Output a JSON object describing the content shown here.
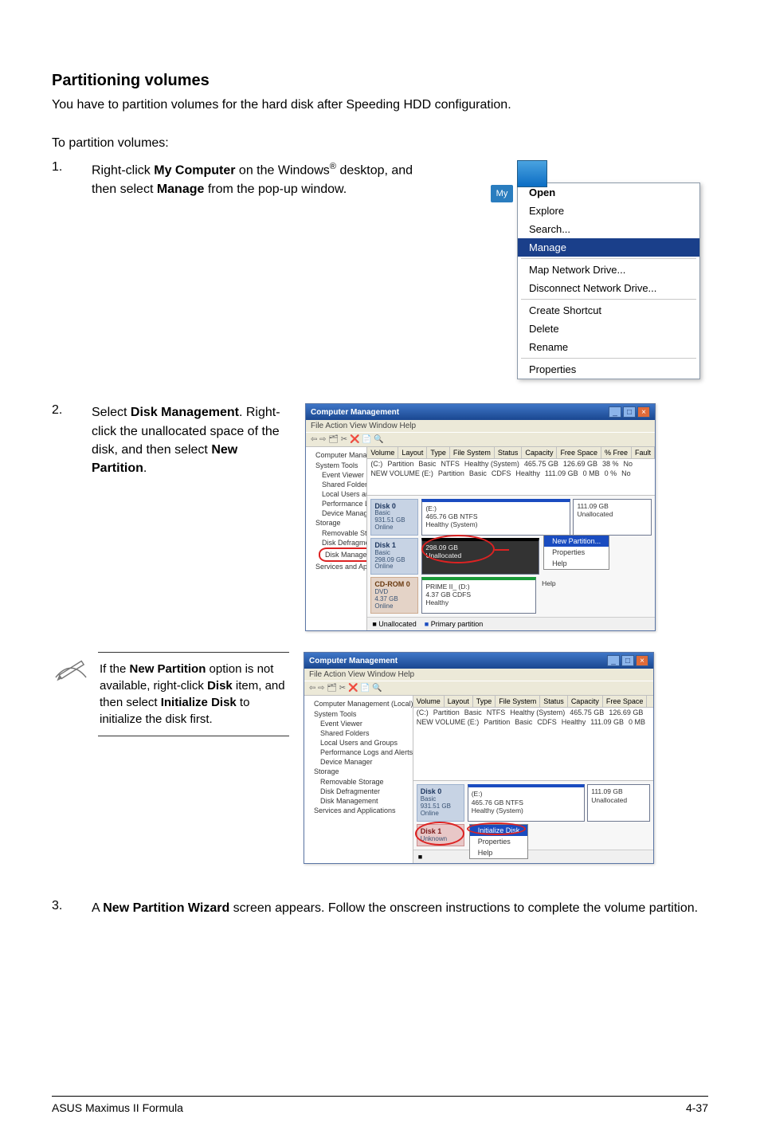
{
  "heading": "Partitioning volumes",
  "intro": "You have to partition volumes for the hard disk after Speeding HDD configuration.",
  "subhead": "To partition volumes:",
  "steps": {
    "s1_num": "1.",
    "s1_a": "Right-click ",
    "s1_bold1": "My Computer",
    "s1_b": " on the Windows",
    "s1_sup": "®",
    "s1_c": " desktop, and then select ",
    "s1_bold2": "Manage",
    "s1_d": " from the pop-up window.",
    "s2_num": "2.",
    "s2_a": "Select ",
    "s2_bold1": "Disk Management",
    "s2_b": ". Right-click the unallocated space of the disk, and then select ",
    "s2_bold2": "New Partition",
    "s2_c": ".",
    "s3_num": "3.",
    "s3_a": "A ",
    "s3_bold": "New Partition Wizard",
    "s3_b": " screen appears. Follow the onscreen instructions to complete the volume partition."
  },
  "note": {
    "a": "If the ",
    "bold1": "New Partition",
    "b": " option is not available, right-click ",
    "bold2": "Disk",
    "c": " item, and then select ",
    "bold3": "Initialize Disk",
    "d": " to initialize the disk first."
  },
  "context_menu": {
    "my": "My",
    "open": "Open",
    "explore": "Explore",
    "search": "Search...",
    "manage": "Manage",
    "map": "Map Network Drive...",
    "disconnect": "Disconnect Network Drive...",
    "shortcut": "Create Shortcut",
    "delete": "Delete",
    "rename": "Rename",
    "properties": "Properties"
  },
  "win1": {
    "title": "Computer Management",
    "menu": "File   Action   View   Window   Help",
    "toolbar": "⇦  ⇨   🗂  ✂  ❌  📄  🔍",
    "tree": {
      "root": "Computer Management (Local)",
      "n1": "System Tools",
      "n2": "Event Viewer",
      "n3": "Shared Folders",
      "n4": "Local Users and Groups",
      "n5": "Performance Logs and Alerts",
      "n6": "Device Manager",
      "n7": "Storage",
      "n8": "Removable Storage",
      "n9": "Disk Defragmenter",
      "sel": "Disk Management",
      "n10": "Services and Applications"
    },
    "cols": {
      "c1": "Volume",
      "c2": "Layout",
      "c3": "Type",
      "c4": "File System",
      "c5": "Status",
      "c6": "Capacity",
      "c7": "Free Space",
      "c8": "% Free",
      "c9": "Fault"
    },
    "rows": {
      "r1v": "(C:)",
      "r1l": "Partition",
      "r1t": "Basic",
      "r1f": "NTFS",
      "r1s": "Healthy (System)",
      "r1c": "465.75 GB",
      "r1fs": "126.69 GB",
      "r1p": "38 %",
      "r1ft": "No",
      "r2v": "NEW VOLUME (E:)",
      "r2l": "Partition",
      "r2t": "Basic",
      "r2f": "CDFS",
      "r2s": "Healthy",
      "r2c": "111.09 GB",
      "r2fs": "0 MB",
      "r2p": "0 %",
      "r2ft": "No"
    },
    "disk0": {
      "label": "Disk 0",
      "sub1": "Basic",
      "sub2": "931.51 GB",
      "sub3": "Online",
      "p1_title": "(E:)",
      "p1_sub": "465.76 GB NTFS",
      "p1_stat": "Healthy (System)",
      "p2_title": "",
      "p2_sub": "111.09 GB",
      "p2_stat": "Unallocated"
    },
    "disk1": {
      "label": "Disk 1",
      "sub1": "Basic",
      "sub2": "298.09 GB",
      "sub3": "Online",
      "p1_sub": "298.09 GB",
      "p1_stat": "Unallocated",
      "np": "New Partition..."
    },
    "cd": {
      "label": "CD-ROM 0",
      "sub1": "DVD",
      "sub2": "4.37 GB",
      "sub3": "Online",
      "p1_title": "PRIME II_ (D:)",
      "p1_sub": "4.37 GB CDFS",
      "p1_stat": "Healthy",
      "help": "Help"
    },
    "legend": {
      "un": "Unallocated",
      "pr": "Primary partition"
    }
  },
  "win2": {
    "title": "Computer Management",
    "menu": "File   Action   View   Window   Help",
    "tree": {
      "root": "Computer Management (Local)",
      "n1": "System Tools",
      "n2": "Event Viewer",
      "n3": "Shared Folders",
      "n4": "Local Users and Groups",
      "n5": "Performance Logs and Alerts",
      "n6": "Device Manager",
      "n7": "Storage",
      "n8": "Removable Storage",
      "n9": "Disk Defragmenter",
      "n10": "Disk Management",
      "n11": "Services and Applications"
    },
    "cols": {
      "c1": "Volume",
      "c2": "Layout",
      "c3": "Type",
      "c4": "File System",
      "c5": "Status",
      "c6": "Capacity",
      "c7": "Free Space"
    },
    "rows": {
      "r1v": "(C:)",
      "r1l": "Partition",
      "r1t": "Basic",
      "r1f": "NTFS",
      "r1s": "Healthy (System)",
      "r1c": "465.75 GB",
      "r1fs": "126.69 GB",
      "r2v": "NEW VOLUME (E:)",
      "r2l": "Partition",
      "r2t": "Basic",
      "r2f": "CDFS",
      "r2s": "Healthy",
      "r2c": "111.09 GB",
      "r2fs": "0 MB"
    },
    "disk0": {
      "label": "Disk 0",
      "sub1": "Basic",
      "sub2": "931.51 GB",
      "sub3": "Online",
      "p1_title": "(E:)",
      "p1_sub": "465.76 GB NTFS",
      "p1_stat": "Healthy (System)",
      "p2_sub": "111.09 GB",
      "p2_stat": "Unallocated"
    },
    "disk1": {
      "label": "Disk 1",
      "sub1": "Unknown",
      "ctx_init": "Initialize Disk",
      "p1_sub": "Properties",
      "p1_stat": "Help"
    },
    "legend": {
      "un": " "
    }
  },
  "footer": {
    "left": "ASUS Maximus II Formula",
    "right": "4-37"
  }
}
